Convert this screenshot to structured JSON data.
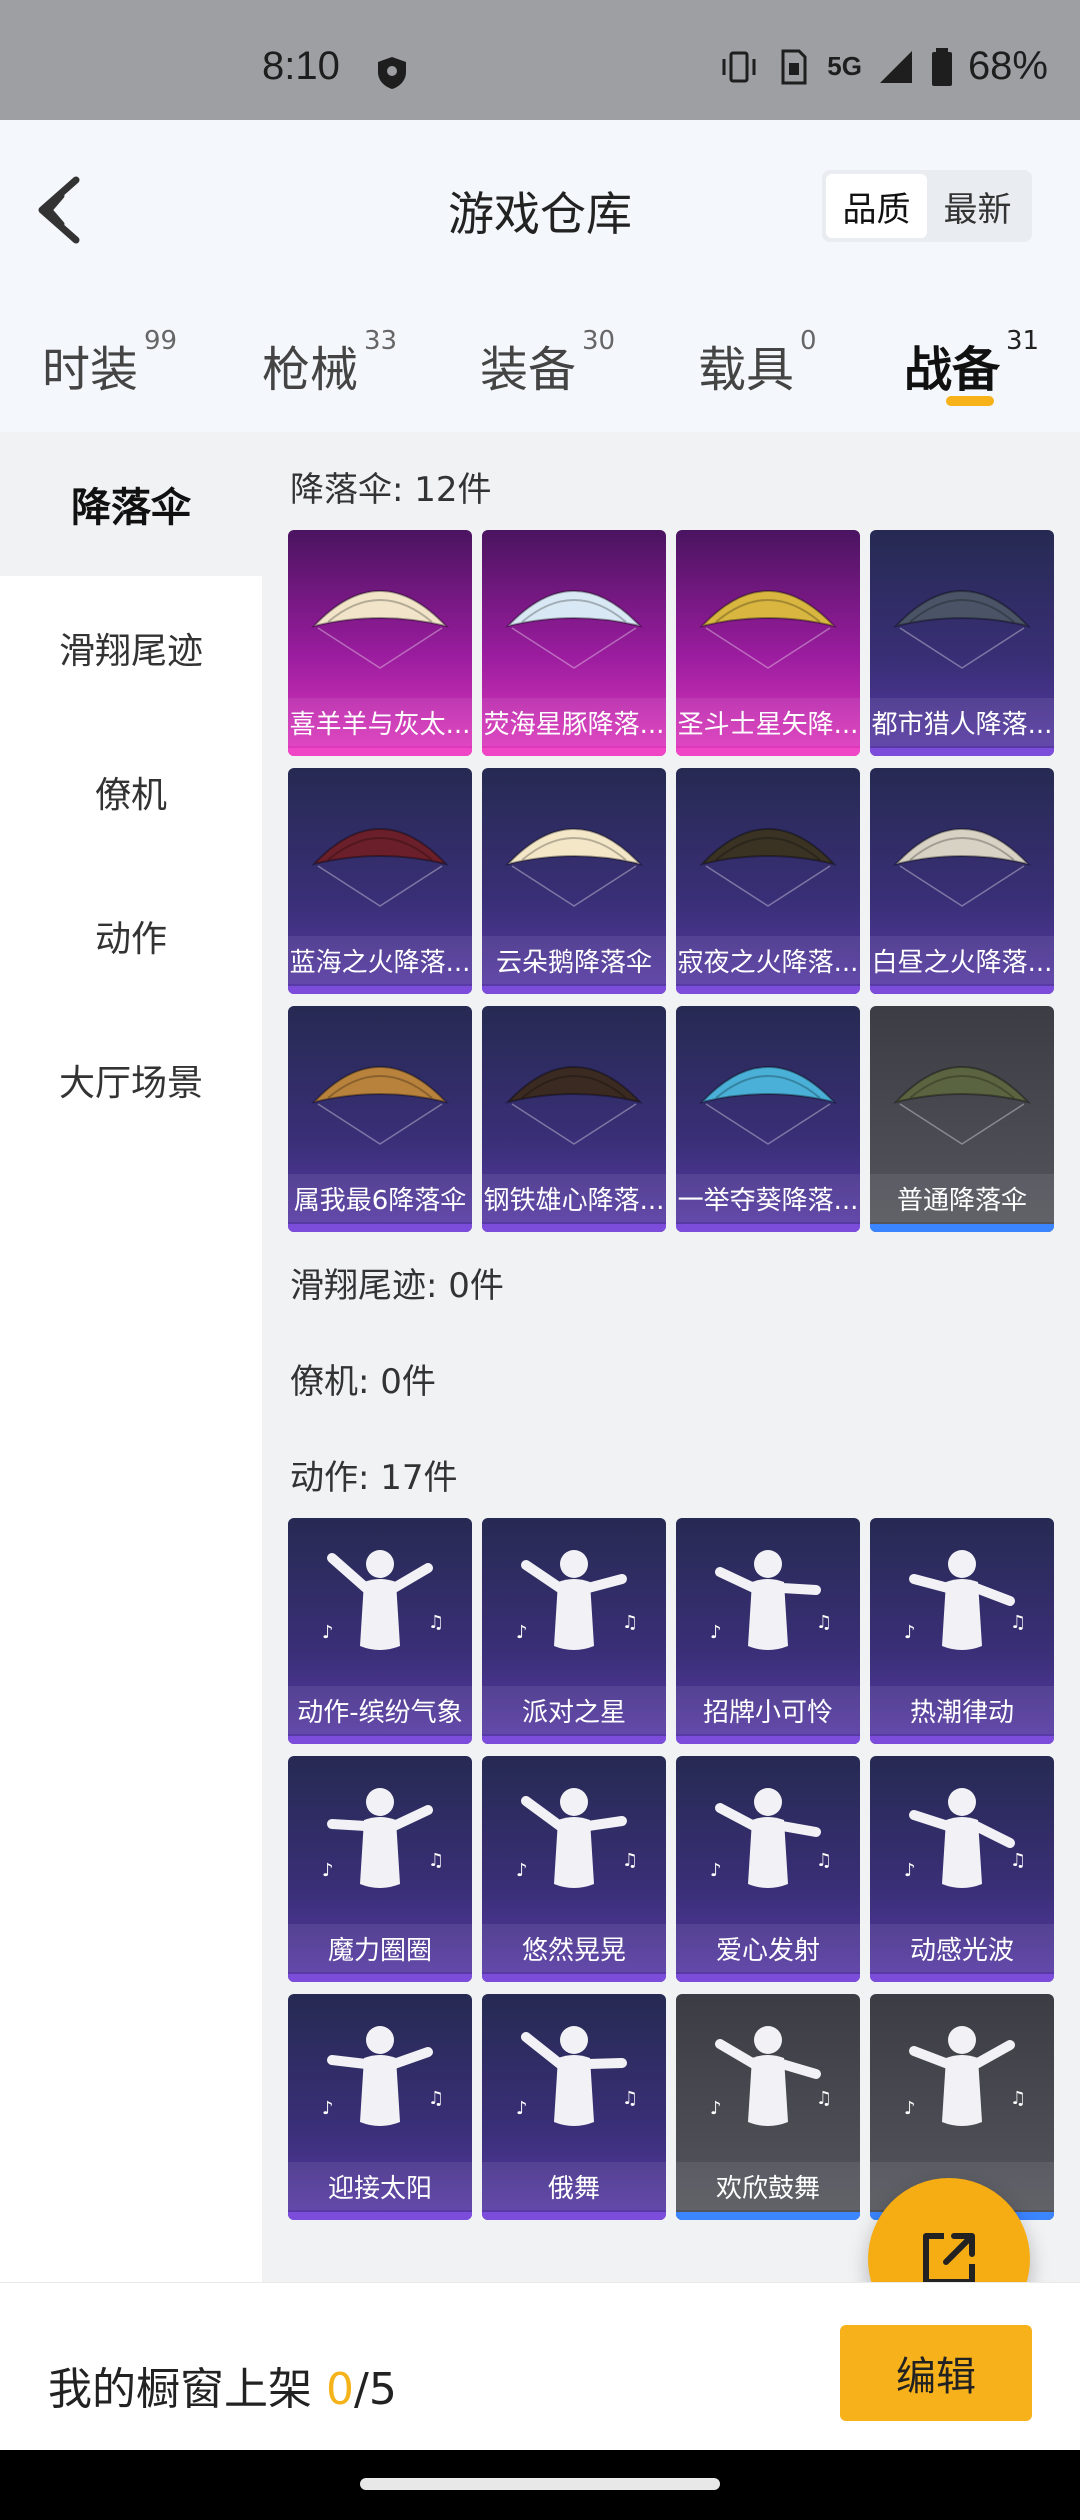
{
  "status_bar": {
    "time": "8:10",
    "network": "5G",
    "battery": "68%"
  },
  "header": {
    "title": "游戏仓库",
    "sort": [
      "品质",
      "最新"
    ],
    "sort_active": 0
  },
  "tabs": [
    {
      "label": "时装",
      "count": "99"
    },
    {
      "label": "枪械",
      "count": "33"
    },
    {
      "label": "装备",
      "count": "30"
    },
    {
      "label": "载具",
      "count": "0"
    },
    {
      "label": "战备",
      "count": "31"
    }
  ],
  "sidebar": {
    "items": [
      "降落伞",
      "滑翔尾迹",
      "僚机",
      "动作",
      "大厅场景"
    ]
  },
  "sections": {
    "parachute": {
      "title": "降落伞: 12件",
      "items": [
        "喜羊羊与灰太...",
        "荧海星豚降落...",
        "圣斗士星矢降...",
        "都市猎人降落...",
        "蓝海之火降落...",
        "云朵鹅降落伞",
        "寂夜之火降落...",
        "白昼之火降落...",
        "属我最6降落伞",
        "钢铁雄心降落...",
        "一举夺葵降落...",
        "普通降落伞"
      ]
    },
    "trail": {
      "title": "滑翔尾迹: 0件"
    },
    "wingman": {
      "title": "僚机: 0件"
    },
    "emote": {
      "title": "动作: 17件",
      "items": [
        "动作-缤纷气象",
        "派对之星",
        "招牌小可怜",
        "热潮律动",
        "魔力圈圈",
        "悠然晃晃",
        "爱心发射",
        "动感光波",
        "迎接太阳",
        "俄舞",
        "欢欣鼓舞",
        ""
      ]
    }
  },
  "bottom": {
    "prefix": "我的橱窗上架 ",
    "count": "0",
    "suffix": "/5",
    "edit": "编辑"
  },
  "colors": {
    "accent": "#f6b218",
    "epic_purple": "#7c4ddb",
    "legend_pink": "#ef46c6",
    "common_blue": "#3b85ff"
  }
}
